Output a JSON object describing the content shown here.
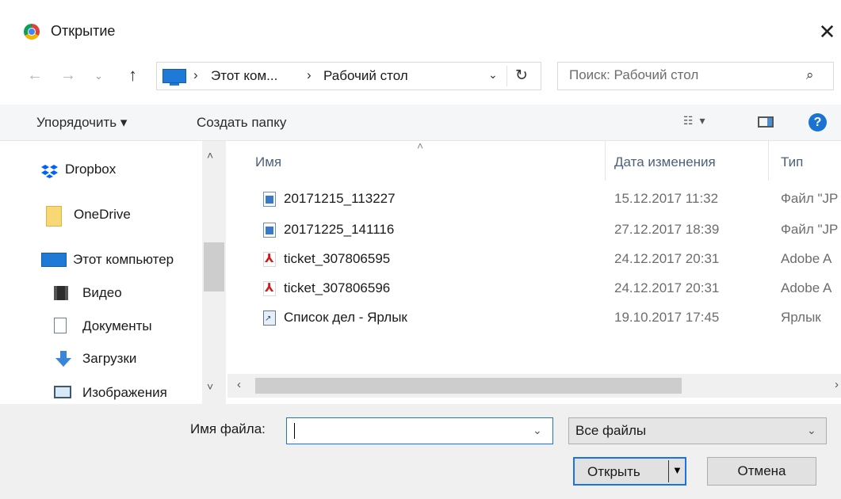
{
  "window": {
    "title": "Открытие",
    "close": "✕"
  },
  "nav": {
    "back": "←",
    "forward": "→",
    "recent": "⌄",
    "up": "↑",
    "breadcrumbs": [
      "Этот ком...",
      "Рабочий стол"
    ],
    "separator": "›",
    "chevron": "⌄",
    "refresh": "↻"
  },
  "search": {
    "placeholder": "Поиск: Рабочий стол",
    "icon": "⌕"
  },
  "toolbar": {
    "organize": "Упорядочить ▾",
    "new_folder": "Создать папку",
    "view": "☷ ▾",
    "help": "?"
  },
  "sidebar": {
    "items": [
      {
        "label": "Dropbox",
        "icon": "dropbox-icon"
      },
      {
        "label": "OneDrive",
        "icon": "folder-icon"
      },
      {
        "label": "Этот компьютер",
        "icon": "computer-icon"
      },
      {
        "label": "Видео",
        "icon": "video-icon"
      },
      {
        "label": "Документы",
        "icon": "documents-icon"
      },
      {
        "label": "Загрузки",
        "icon": "downloads-icon"
      },
      {
        "label": "Изображения",
        "icon": "pictures-icon"
      }
    ],
    "scroll_up": "˄",
    "scroll_down": "˅"
  },
  "columns": {
    "name": "Имя",
    "date": "Дата изменения",
    "type": "Тип",
    "sort": "˄"
  },
  "files": [
    {
      "name": "20171215_113227",
      "date": "15.12.2017 11:32",
      "type": "Файл \"JP",
      "icon": "image-icon"
    },
    {
      "name": "20171225_141116",
      "date": "27.12.2017 18:39",
      "type": "Файл \"JP",
      "icon": "image-icon"
    },
    {
      "name": "ticket_307806595",
      "date": "24.12.2017 20:31",
      "type": "Adobe A",
      "icon": "pdf-icon"
    },
    {
      "name": "ticket_307806596",
      "date": "24.12.2017 20:31",
      "type": "Adobe A",
      "icon": "pdf-icon"
    },
    {
      "name": "Список дел - Ярлык",
      "date": "19.10.2017 17:45",
      "type": "Ярлык",
      "icon": "shortcut-icon"
    }
  ],
  "hscroll": {
    "left": "‹",
    "right": "›"
  },
  "footer": {
    "filename_label": "Имя файла:",
    "filename_value": "",
    "filter": "Все файлы",
    "dropdown": "⌄",
    "open": "Открыть",
    "open_arrow": "▼",
    "cancel": "Отмена"
  }
}
